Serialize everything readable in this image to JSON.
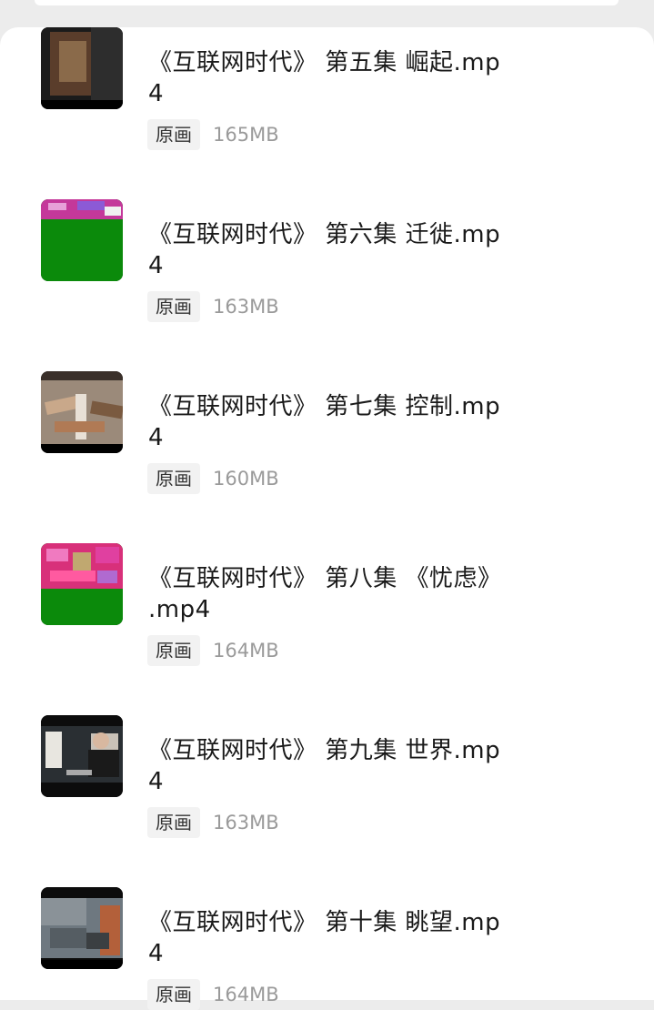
{
  "files": [
    {
      "title_line1": "《互联网时代》 第五集 崛起.mp",
      "title_line2": "4",
      "tag": "原画",
      "size": "165MB",
      "thumb_icon": "video-thumbnail-dark-icon"
    },
    {
      "title_line1": "《互联网时代》 第六集 迁徙.mp",
      "title_line2": "4",
      "tag": "原画",
      "size": "163MB",
      "thumb_icon": "video-thumbnail-green-icon"
    },
    {
      "title_line1": "《互联网时代》 第七集 控制.mp",
      "title_line2": "4",
      "tag": "原画",
      "size": "160MB",
      "thumb_icon": "video-thumbnail-hands-icon"
    },
    {
      "title_line1": "《互联网时代》 第八集 《忧虑》",
      "title_line2": ".mp4",
      "tag": "原画",
      "size": "164MB",
      "thumb_icon": "video-thumbnail-glitch-icon"
    },
    {
      "title_line1": "《互联网时代》 第九集 世界.mp",
      "title_line2": "4",
      "tag": "原画",
      "size": "163MB",
      "thumb_icon": "video-thumbnail-person-icon"
    },
    {
      "title_line1": "《互联网时代》 第十集 眺望.mp",
      "title_line2": "4",
      "tag": "原画",
      "size": "164MB",
      "thumb_icon": "video-thumbnail-street-icon"
    }
  ],
  "colors": {
    "background": "#ececec",
    "sheet": "#ffffff",
    "title": "#1a1a1a",
    "tag_bg": "#f2f2f2",
    "size_text": "#9a9a9a"
  }
}
